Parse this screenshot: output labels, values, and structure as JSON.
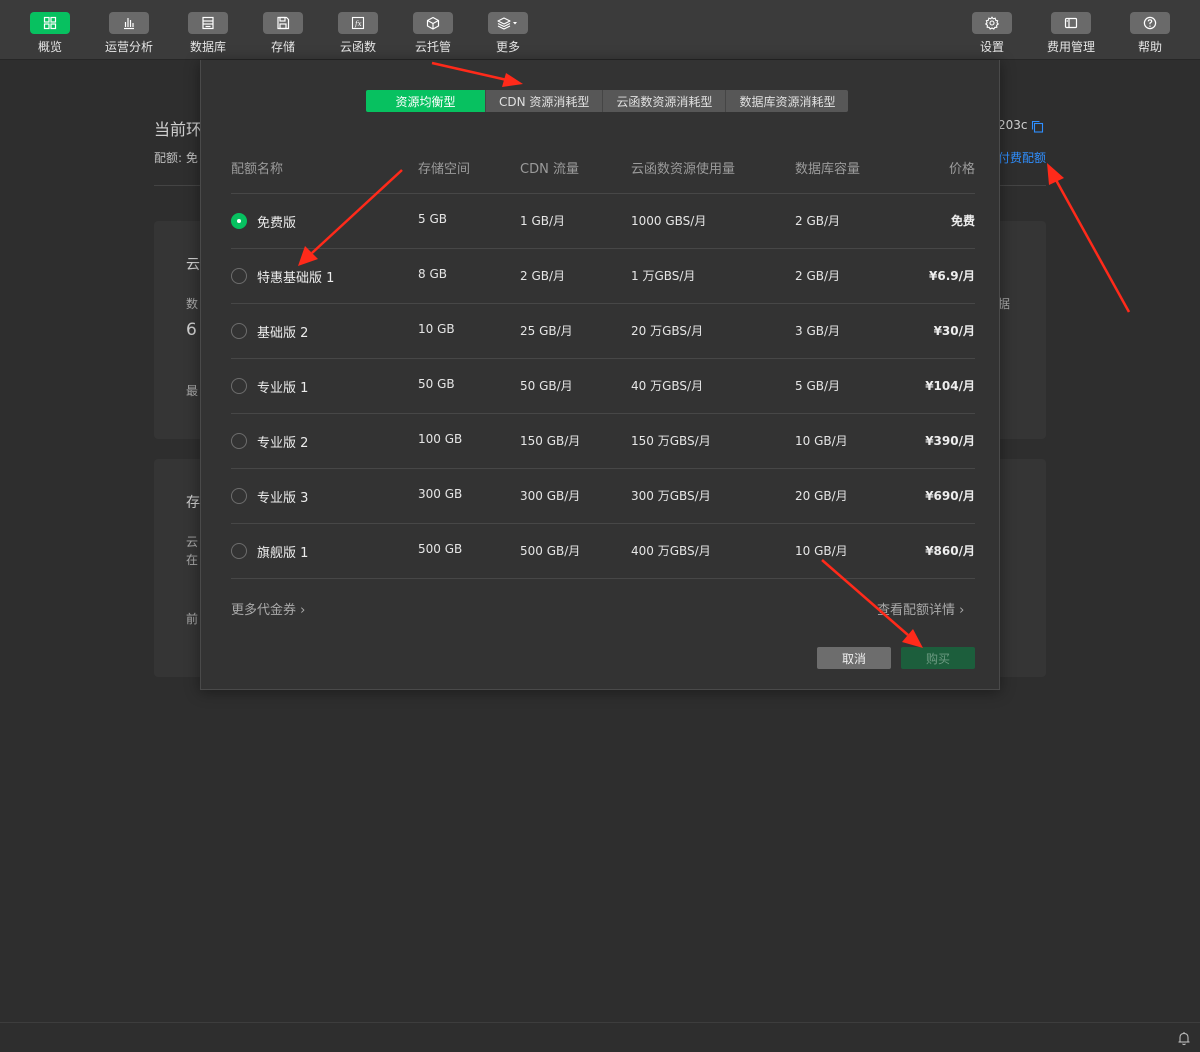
{
  "toolbar": {
    "left_items": [
      {
        "label": "概览",
        "icon": "overview-grid-icon",
        "active": true
      },
      {
        "label": "运营分析",
        "icon": "bar-chart-icon"
      },
      {
        "label": "数据库",
        "icon": "database-icon"
      },
      {
        "label": "存储",
        "icon": "storage-disk-icon"
      },
      {
        "label": "云函数",
        "icon": "cloud-function-icon"
      },
      {
        "label": "云托管",
        "icon": "cloud-hosting-cube-icon"
      },
      {
        "label": "更多",
        "icon": "layers-more-icon"
      }
    ],
    "right_items": [
      {
        "label": "设置",
        "icon": "gear-icon"
      },
      {
        "label": "费用管理",
        "icon": "billing-icon"
      },
      {
        "label": "帮助",
        "icon": "help-icon"
      }
    ]
  },
  "background": {
    "title_fragment": "当前环",
    "env_id_fragment": "203c",
    "quota_fragment": "配额: 免",
    "paid_link_fragment": "付费配额",
    "card1": {
      "title": "云",
      "label": "数",
      "value": "6",
      "note": "最",
      "right_fragment": "据"
    },
    "card2": {
      "title": "存",
      "line1": "云",
      "line2": "在",
      "note": "前"
    }
  },
  "dialog": {
    "tabs": [
      "资源均衡型",
      "CDN 资源消耗型",
      "云函数资源消耗型",
      "数据库资源消耗型"
    ],
    "active_tab": 0,
    "headers": {
      "name": "配额名称",
      "storage": "存储空间",
      "cdn": "CDN 流量",
      "func": "云函数资源使用量",
      "db": "数据库容量",
      "price": "价格"
    },
    "rows": [
      {
        "name": "免费版",
        "storage": "5 GB",
        "cdn": "1 GB/月",
        "func": "1000 GBS/月",
        "db": "2 GB/月",
        "price": "免费",
        "selected": true
      },
      {
        "name": "特惠基础版 1",
        "storage": "8 GB",
        "cdn": "2 GB/月",
        "func": "1 万GBS/月",
        "db": "2 GB/月",
        "price": "¥6.9/月",
        "selected": false
      },
      {
        "name": "基础版 2",
        "storage": "10 GB",
        "cdn": "25 GB/月",
        "func": "20 万GBS/月",
        "db": "3 GB/月",
        "price": "¥30/月",
        "selected": false
      },
      {
        "name": "专业版 1",
        "storage": "50 GB",
        "cdn": "50 GB/月",
        "func": "40 万GBS/月",
        "db": "5 GB/月",
        "price": "¥104/月",
        "selected": false
      },
      {
        "name": "专业版 2",
        "storage": "100 GB",
        "cdn": "150 GB/月",
        "func": "150 万GBS/月",
        "db": "10 GB/月",
        "price": "¥390/月",
        "selected": false
      },
      {
        "name": "专业版 3",
        "storage": "300 GB",
        "cdn": "300 GB/月",
        "func": "300 万GBS/月",
        "db": "20 GB/月",
        "price": "¥690/月",
        "selected": false
      },
      {
        "name": "旗舰版 1",
        "storage": "500 GB",
        "cdn": "500 GB/月",
        "func": "400 万GBS/月",
        "db": "10 GB/月",
        "price": "¥860/月",
        "selected": false
      }
    ],
    "more_vouchers": "更多代金券 ›",
    "view_details": "查看配额详情 ›",
    "cancel": "取消",
    "buy": "购买"
  },
  "colors": {
    "accent": "#07c160",
    "link": "#2f8fff",
    "annotation_arrow": "#ff2a1a",
    "background": "#2e2e2e",
    "dialog": "#333333"
  }
}
